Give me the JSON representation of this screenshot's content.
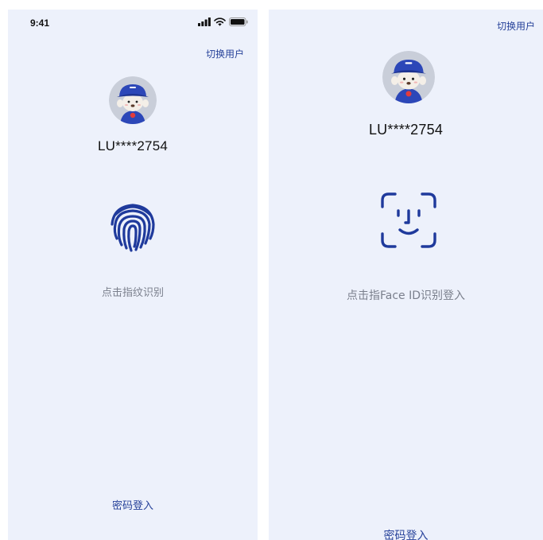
{
  "fingerprint_screen": {
    "status_time": "9:41",
    "switch_user": "切换用户",
    "username": "LU****2754",
    "hint": "点击指纹识别",
    "password_login": "密码登入"
  },
  "faceid_screen": {
    "switch_user": "切换用户",
    "username": "LU****2754",
    "hint": "点击指Face ID识别登入",
    "password_login": "密码登入"
  },
  "colors": {
    "background": "#edf1fb",
    "accent": "#27429a",
    "hint_text": "#7a7f8c",
    "username_text": "#111111"
  },
  "icons": [
    "signal-icon",
    "wifi-icon",
    "battery-icon",
    "fingerprint-icon",
    "face-id-icon",
    "avatar-mascot"
  ]
}
